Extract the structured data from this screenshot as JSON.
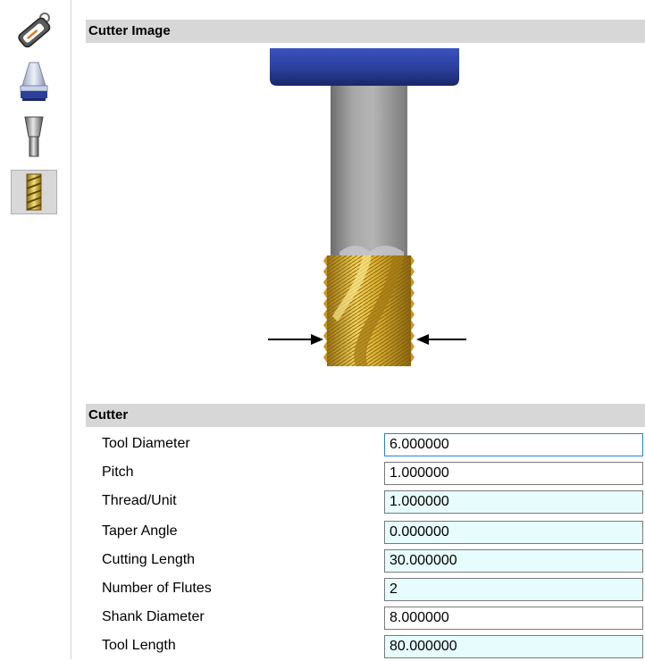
{
  "toolbar": {
    "items": [
      {
        "name": "tag-icon",
        "selected": false
      },
      {
        "name": "holder-icon",
        "selected": false
      },
      {
        "name": "extension-icon",
        "selected": false
      },
      {
        "name": "thread-mill-icon",
        "selected": true
      }
    ]
  },
  "image_section": {
    "title": "Cutter Image"
  },
  "cutter_section": {
    "title": "Cutter",
    "params": [
      {
        "label": "Tool Diameter",
        "value": "6.000000"
      },
      {
        "label": "Pitch",
        "value": "1.000000"
      },
      {
        "label": "Thread/Unit",
        "value": "1.000000"
      },
      {
        "label": "Taper Angle",
        "value": "0.000000"
      },
      {
        "label": "Cutting Length",
        "value": "30.000000"
      },
      {
        "label": "Number of Flutes",
        "value": "2"
      },
      {
        "label": "Shank Diameter",
        "value": "8.000000"
      },
      {
        "label": "Tool Length",
        "value": "80.000000"
      }
    ]
  },
  "colors": {
    "holder_blue": "#2b3f9c",
    "flute_gold": "#d4a82a",
    "shank_gray": "#8a8a8a",
    "input_tint": "#e7fdfd",
    "focus_border": "#2f7fd6"
  }
}
